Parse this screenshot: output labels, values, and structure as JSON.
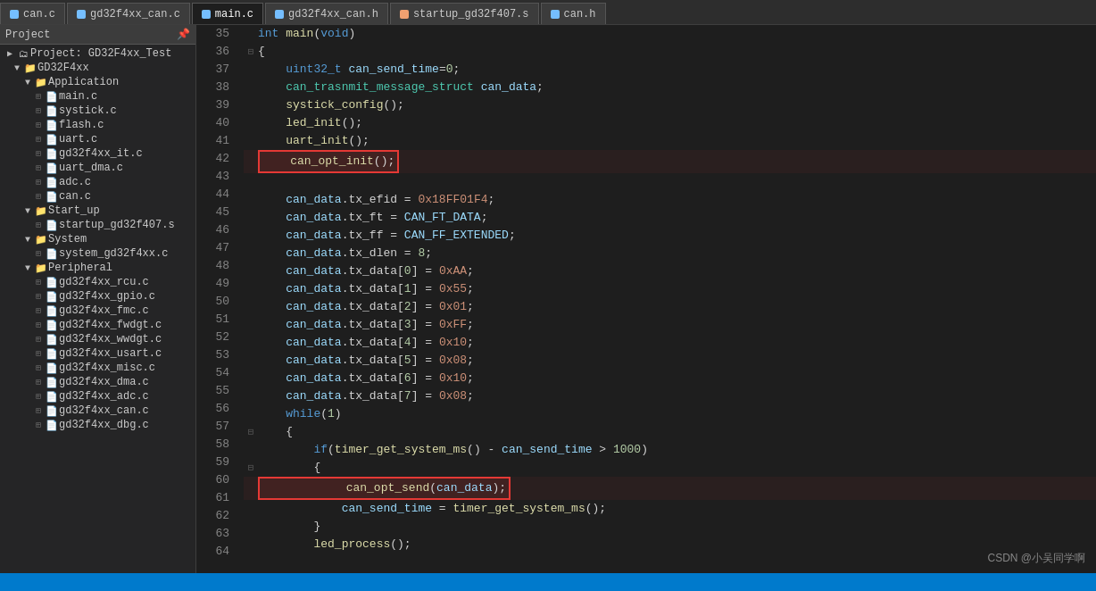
{
  "tabs": [
    {
      "id": "can-c",
      "label": "can.c",
      "color": "#75beff",
      "active": false
    },
    {
      "id": "gd32f4xx-can-c",
      "label": "gd32f4xx_can.c",
      "color": "#75beff",
      "active": false
    },
    {
      "id": "main-c",
      "label": "main.c",
      "color": "#75beff",
      "active": true
    },
    {
      "id": "gd32f4xx-can-h",
      "label": "gd32f4xx_can.h",
      "color": "#75beff",
      "active": false
    },
    {
      "id": "startup-s",
      "label": "startup_gd32f407.s",
      "color": "#f0a070",
      "active": false
    },
    {
      "id": "can-h",
      "label": "can.h",
      "color": "#75beff",
      "active": false
    }
  ],
  "sidebar": {
    "header": "Project",
    "project_name": "Project: GD32F4xx_Test",
    "tree": [
      {
        "level": 0,
        "type": "root",
        "label": "GD32F4xx",
        "arrow": "▼",
        "icon": "📁"
      },
      {
        "level": 1,
        "type": "folder",
        "label": "Application",
        "arrow": "▼",
        "icon": "📁"
      },
      {
        "level": 2,
        "type": "file",
        "label": "main.c",
        "icon": "c"
      },
      {
        "level": 2,
        "type": "file",
        "label": "systick.c",
        "icon": "c"
      },
      {
        "level": 2,
        "type": "file",
        "label": "flash.c",
        "icon": "c"
      },
      {
        "level": 2,
        "type": "file",
        "label": "uart.c",
        "icon": "c"
      },
      {
        "level": 2,
        "type": "file",
        "label": "gd32f4xx_it.c",
        "icon": "c"
      },
      {
        "level": 2,
        "type": "file",
        "label": "uart_dma.c",
        "icon": "c"
      },
      {
        "level": 2,
        "type": "file",
        "label": "adc.c",
        "icon": "c"
      },
      {
        "level": 2,
        "type": "file",
        "label": "can.c",
        "icon": "c"
      },
      {
        "level": 1,
        "type": "folder",
        "label": "Start_up",
        "arrow": "▼",
        "icon": "📁"
      },
      {
        "level": 2,
        "type": "file",
        "label": "startup_gd32f407.s",
        "icon": "s"
      },
      {
        "level": 1,
        "type": "folder",
        "label": "System",
        "arrow": "▼",
        "icon": "📁"
      },
      {
        "level": 2,
        "type": "file",
        "label": "system_gd32f4xx.c",
        "icon": "c"
      },
      {
        "level": 1,
        "type": "folder",
        "label": "Peripheral",
        "arrow": "▼",
        "icon": "📁"
      },
      {
        "level": 2,
        "type": "file",
        "label": "gd32f4xx_rcu.c",
        "icon": "c"
      },
      {
        "level": 2,
        "type": "file",
        "label": "gd32f4xx_gpio.c",
        "icon": "c"
      },
      {
        "level": 2,
        "type": "file",
        "label": "gd32f4xx_fmc.c",
        "icon": "c"
      },
      {
        "level": 2,
        "type": "file",
        "label": "gd32f4xx_fwdgt.c",
        "icon": "c"
      },
      {
        "level": 2,
        "type": "file",
        "label": "gd32f4xx_wwdgt.c",
        "icon": "c"
      },
      {
        "level": 2,
        "type": "file",
        "label": "gd32f4xx_usart.c",
        "icon": "c"
      },
      {
        "level": 2,
        "type": "file",
        "label": "gd32f4xx_misc.c",
        "icon": "c"
      },
      {
        "level": 2,
        "type": "file",
        "label": "gd32f4xx_dma.c",
        "icon": "c"
      },
      {
        "level": 2,
        "type": "file",
        "label": "gd32f4xx_adc.c",
        "icon": "c"
      },
      {
        "level": 2,
        "type": "file",
        "label": "gd32f4xx_can.c",
        "icon": "c"
      },
      {
        "level": 2,
        "type": "file",
        "label": "gd32f4xx_dbg.c",
        "icon": "c"
      }
    ]
  },
  "lines": [
    {
      "num": 35,
      "fold": "",
      "code": "int main(void)"
    },
    {
      "num": 36,
      "fold": "⊟",
      "code": "{"
    },
    {
      "num": 37,
      "fold": "",
      "code": "    uint32_t can_send_time=0;"
    },
    {
      "num": 38,
      "fold": "",
      "code": "    can_trasnmit_message_struct can_data;"
    },
    {
      "num": 39,
      "fold": "",
      "code": "    systick_config();"
    },
    {
      "num": 40,
      "fold": "",
      "code": "    led_init();"
    },
    {
      "num": 41,
      "fold": "",
      "code": "    uart_init();"
    },
    {
      "num": 42,
      "fold": "",
      "code": "    can_opt_init();",
      "highlight": true
    },
    {
      "num": 43,
      "fold": "",
      "code": ""
    },
    {
      "num": 44,
      "fold": "",
      "code": "    can_data.tx_efid = 0x18FF01F4;"
    },
    {
      "num": 45,
      "fold": "",
      "code": "    can_data.tx_ft = CAN_FT_DATA;"
    },
    {
      "num": 46,
      "fold": "",
      "code": "    can_data.tx_ff = CAN_FF_EXTENDED;"
    },
    {
      "num": 47,
      "fold": "",
      "code": "    can_data.tx_dlen = 8;"
    },
    {
      "num": 48,
      "fold": "",
      "code": "    can_data.tx_data[0] = 0xAA;"
    },
    {
      "num": 49,
      "fold": "",
      "code": "    can_data.tx_data[1] = 0x55;"
    },
    {
      "num": 50,
      "fold": "",
      "code": "    can_data.tx_data[2] = 0x01;"
    },
    {
      "num": 51,
      "fold": "",
      "code": "    can_data.tx_data[3] = 0xFF;"
    },
    {
      "num": 52,
      "fold": "",
      "code": "    can_data.tx_data[4] = 0x10;"
    },
    {
      "num": 53,
      "fold": "",
      "code": "    can_data.tx_data[5] = 0x08;"
    },
    {
      "num": 54,
      "fold": "",
      "code": "    can_data.tx_data[6] = 0x10;"
    },
    {
      "num": 55,
      "fold": "",
      "code": "    can_data.tx_data[7] = 0x08;"
    },
    {
      "num": 56,
      "fold": "",
      "code": "    while(1)"
    },
    {
      "num": 57,
      "fold": "⊟",
      "code": "    {"
    },
    {
      "num": 58,
      "fold": "",
      "code": "        if(timer_get_system_ms() - can_send_time > 1000)"
    },
    {
      "num": 59,
      "fold": "⊟",
      "code": "        {"
    },
    {
      "num": 60,
      "fold": "",
      "code": "            can_opt_send(can_data);",
      "highlight": true
    },
    {
      "num": 61,
      "fold": "",
      "code": "            can_send_time = timer_get_system_ms();"
    },
    {
      "num": 62,
      "fold": "",
      "code": "        }"
    },
    {
      "num": 63,
      "fold": "",
      "code": "        led_process();"
    },
    {
      "num": 64,
      "fold": "",
      "code": ""
    }
  ],
  "watermark": "CSDN @小吴同学啊",
  "status": ""
}
